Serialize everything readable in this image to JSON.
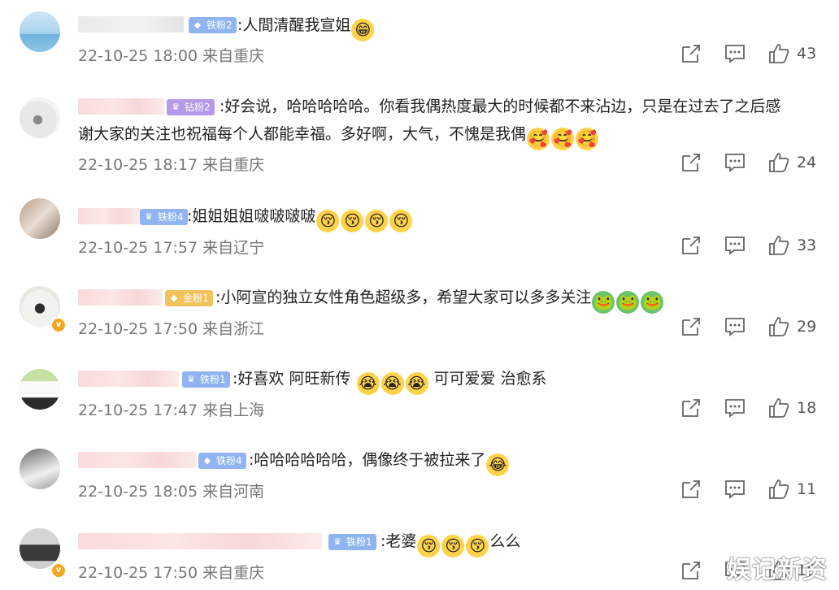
{
  "comments": [
    {
      "text_parts": [
        ":人間清醒我宣姐"
      ],
      "badge": {
        "label": "铁粉2",
        "type": "iron",
        "icon": "diamond-icon"
      },
      "emojis": [
        "grin"
      ],
      "date": "22-10-25 18:00",
      "location": "来自重庆",
      "likes": "43"
    },
    {
      "text_parts": [
        ":好会说，哈哈哈哈哈。你看我偶热度最大的时候都不来沾边，只是在过去了之后感",
        "谢大家的关注也祝福每个人都能幸福。多好啊，大气，不愧是我偶"
      ],
      "badge": {
        "label": "钻粉2",
        "type": "diamond",
        "icon": "crown-icon"
      },
      "emojis": [
        "love",
        "love",
        "love"
      ],
      "date": "22-10-25 18:17",
      "location": "来自重庆",
      "likes": "24"
    },
    {
      "text_parts": [
        ":姐姐姐姐啵啵啵啵"
      ],
      "badge": {
        "label": "铁粉4",
        "type": "iron",
        "icon": "crown-icon"
      },
      "emojis": [
        "kiss",
        "kiss",
        "kiss",
        "kiss"
      ],
      "date": "22-10-25 17:57",
      "location": "来自辽宁",
      "likes": "33"
    },
    {
      "text_parts": [
        ":小阿宣的独立女性角色超级多，希望大家可以多多关注"
      ],
      "badge": {
        "label": "金粉1",
        "type": "gold",
        "icon": "diamond-icon"
      },
      "emojis": [
        "frog",
        "frog",
        "frog"
      ],
      "date": "22-10-25 17:50",
      "location": "来自浙江",
      "likes": "29"
    },
    {
      "text_parts": [
        ":好喜欢 阿旺新传",
        "可可爱爱 治愈系"
      ],
      "badge": {
        "label": "铁粉1",
        "type": "iron",
        "icon": "crown-icon"
      },
      "emojis": [
        "cry",
        "cry",
        "cry"
      ],
      "date": "22-10-25 17:47",
      "location": "来自上海",
      "likes": "18"
    },
    {
      "text_parts": [
        ":哈哈哈哈哈哈，偶像终于被拉来了"
      ],
      "badge": {
        "label": "铁粉4",
        "type": "iron",
        "icon": "diamond-icon"
      },
      "emojis": [
        "laugh"
      ],
      "date": "22-10-25 18:05",
      "location": "来自河南",
      "likes": "11"
    },
    {
      "text_parts": [
        ":老婆",
        "么么"
      ],
      "badge": {
        "label": "铁粉1",
        "type": "iron",
        "icon": "crown-icon"
      },
      "emojis": [
        "kiss",
        "kiss",
        "kiss"
      ],
      "date": "22-10-25 17:50",
      "location": "来自重庆",
      "likes": "15"
    }
  ],
  "watermark": "娱记新资",
  "colors": {
    "iron": "#8fb4ef",
    "gold": "#f2c25c",
    "diamond": "#b59ae8",
    "emoji": "#ffd24a"
  }
}
